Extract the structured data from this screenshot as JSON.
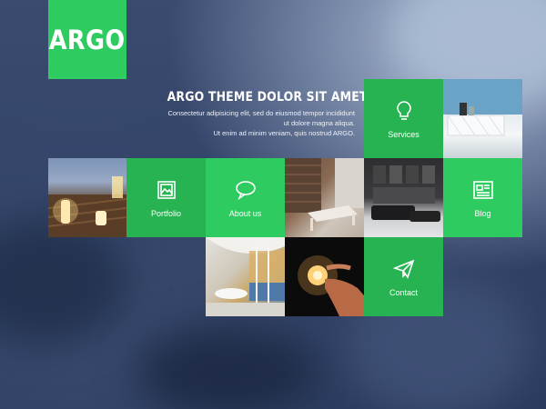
{
  "logo": {
    "text": "ARGO"
  },
  "hero": {
    "title": "ARGO THEME DOLOR SIT AMET TELASDE",
    "lines": [
      "Consectetur adipisicing elit, sed do eiusmod tempor incididunt",
      "ut dolore magna aliqua.",
      "Ut enim ad minim veniam, quis nostrud ARGO."
    ]
  },
  "tiles": {
    "services": {
      "label": "Services",
      "icon": "lightbulb-icon"
    },
    "portfolio": {
      "label": "Portfolio",
      "icon": "picture-icon"
    },
    "about": {
      "label": "About us",
      "icon": "speech-bubble-icon"
    },
    "blog": {
      "label": "Blog",
      "icon": "newspaper-icon"
    },
    "contact": {
      "label": "Contact",
      "icon": "paper-plane-icon"
    }
  },
  "colors": {
    "accent": "#2ecc60",
    "accent_dark": "#27b352"
  }
}
